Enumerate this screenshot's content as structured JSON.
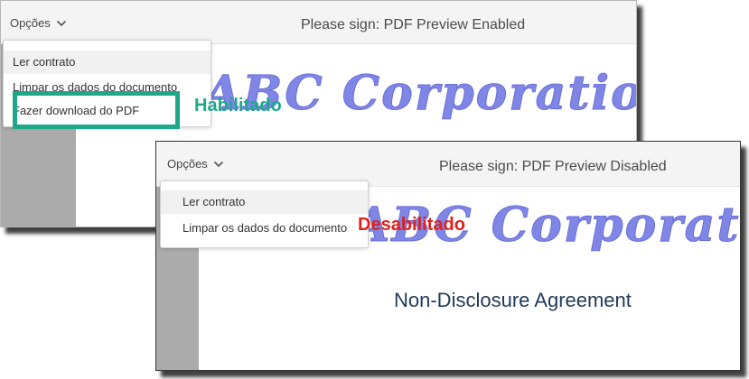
{
  "enabled_window": {
    "options_label": "Opções",
    "title": "Please sign: PDF Preview Enabled",
    "menu": [
      "Ler contrato",
      "Limpar os dados do documento",
      "Fazer download do PDF"
    ],
    "logo_text": "ABC Corporation",
    "callout": "Habilitado"
  },
  "disabled_window": {
    "options_label": "Opções",
    "title": "Please sign: PDF Preview Disabled",
    "menu": [
      "Ler contrato",
      "Limpar os dados do documento"
    ],
    "logo_text": "ABC Corporation",
    "doc_heading": "Non-Disclosure Agreement",
    "callout": "Desabilitado"
  },
  "colors": {
    "enabled_accent": "#1ea88a",
    "disabled_accent": "#e0201b",
    "logo": "#7f86e6",
    "heading": "#1f3a5a",
    "sidebar": "#ababab"
  },
  "icons": {
    "options_chevron": "chevron-down-icon"
  }
}
